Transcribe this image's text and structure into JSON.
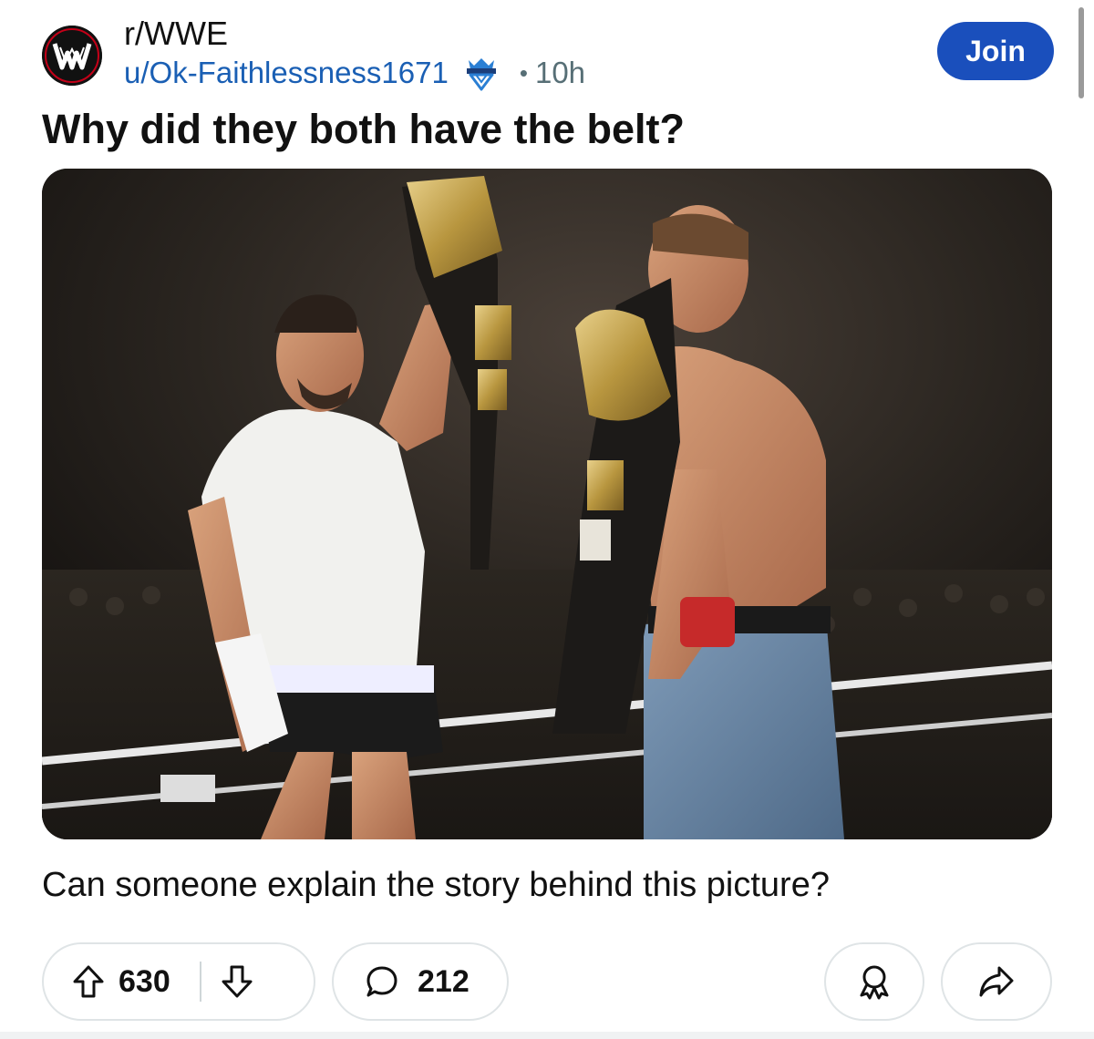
{
  "post": {
    "subreddit": "r/WWE",
    "author": "u/Ok-Faithlessness1671",
    "time_separator": "•",
    "time": "10h",
    "join_label": "Join",
    "title": "Why did they both have the belt?",
    "body": "Can someone explain the story behind this picture?"
  },
  "actions": {
    "upvotes": "630",
    "comments": "212"
  },
  "icons": {
    "subreddit_avatar": "wwe-logo-icon",
    "flair": "diamond-crown-icon",
    "upvote": "upvote-arrow-icon",
    "downvote": "downvote-arrow-icon",
    "comment": "comment-bubble-icon",
    "award": "award-ribbon-icon",
    "share": "share-arrow-icon"
  },
  "colors": {
    "author_link": "#1a5fb4",
    "join_button": "#1a4fbc",
    "meta_text": "#576f76"
  }
}
